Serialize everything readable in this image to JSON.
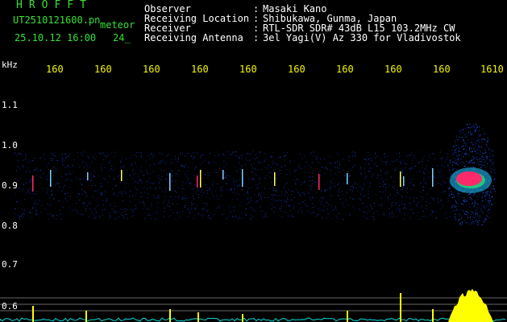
{
  "header": {
    "app_title": "HROFFT",
    "file_name": "UT2510121600.pn",
    "type_label": "meteor",
    "date_time": "25.10.12 16:00",
    "frame_no": "24_"
  },
  "metadata": [
    {
      "key": "Observer",
      "value": "Masaki Kano"
    },
    {
      "key": "Receiving Location",
      "value": "Shibukawa, Gunma, Japan"
    },
    {
      "key": "Receiver",
      "value": "RTL-SDR SDR# 43dB L15 103.2MHz CW"
    },
    {
      "key": "Receiving Antenna",
      "value": "3el Yagi(V) Az 330 for Vladivostok"
    }
  ],
  "separator": ":",
  "axis": {
    "y_unit": "kHz",
    "y_ticks": [
      "1.1",
      "1.0",
      "0.9",
      "0.8",
      "0.7",
      "0.6"
    ],
    "x_ticks": [
      "160",
      "160",
      "160",
      "160",
      "160",
      "160",
      "160",
      "160",
      "160",
      "1610"
    ]
  },
  "colors": {
    "title": "#37e037",
    "label": "#ffffff",
    "tick": "#f5f500",
    "echo": "#ff2a6a",
    "noise": "#1030a0",
    "level": "#ffff00",
    "baseline": "#00e0e0"
  }
}
